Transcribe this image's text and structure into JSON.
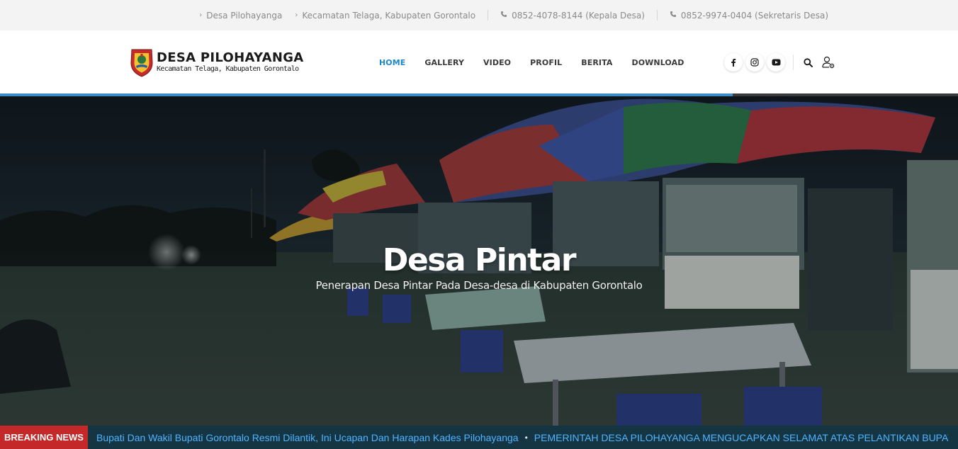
{
  "topbar": {
    "breadcrumb": [
      "Desa Pilohayanga",
      "Kecamatan Telaga, Kabupaten Gorontalo"
    ],
    "phones": [
      "0852-4078-8144 (Kepala Desa)",
      "0852-9974-0404 (Sekretaris Desa)"
    ]
  },
  "logo": {
    "title": "DESA PILOHAYANGA",
    "subtitle": "Kecamatan Telaga, Kabupaten Gorontalo"
  },
  "nav": {
    "items": [
      "HOME",
      "GALLERY",
      "VIDEO",
      "PROFIL",
      "BERITA",
      "DOWNLOAD"
    ],
    "active": "HOME"
  },
  "social": {
    "icons": [
      "facebook-icon",
      "instagram-icon",
      "youtube-icon"
    ]
  },
  "header_icons": [
    "search-icon",
    "user-login-icon"
  ],
  "slider": {
    "progress_fraction": 0.765,
    "title": "Desa Pintar",
    "subtitle": "Penerapan Desa Pintar Pada Desa-desa di Kabupaten Gorontalo"
  },
  "breaking": {
    "label": "BREAKING NEWS",
    "items": [
      "Bupati Dan Wakil Bupati Gorontalo Resmi Dilantik, Ini Ucapan Dan Harapan Kades Pilohayanga",
      "PEMERINTAH DESA PILOHAYANGA MENGUCAPKAN SELAMAT ATAS PELANTIKAN BUPATI DAN WAKIL BUPATI"
    ]
  },
  "colors": {
    "accent": "#1e88c9",
    "progress": "#3c8dc5",
    "breaking_label_bg": "#c42828",
    "ticker_bg": "#163543",
    "ticker_text": "#4fb3ff"
  }
}
